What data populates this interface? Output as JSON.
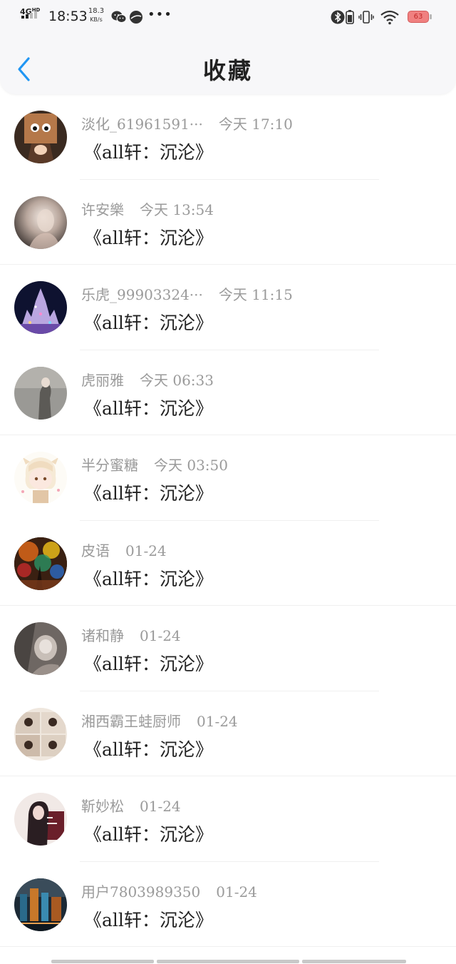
{
  "status_bar": {
    "network": "4G",
    "network_sup": "HD",
    "time": "18:53",
    "speed_value": "18.3",
    "speed_unit": "KB/s",
    "battery": "63",
    "battery_color": "#f08080"
  },
  "header": {
    "title": "收藏",
    "back_icon": "chevron-left-icon",
    "accent": "#2196f3",
    "background": "#f7f7f9"
  },
  "items": [
    {
      "name": "淡化_61961591···",
      "time": "今天 17:10",
      "content": "《all轩：沉沦》"
    },
    {
      "name": "许安樂",
      "time": "今天 13:54",
      "content": "《all轩：沉沦》"
    },
    {
      "name": "乐虎_99903324···",
      "time": "今天 11:15",
      "content": "《all轩：沉沦》"
    },
    {
      "name": "虎丽雅",
      "time": "今天 06:33",
      "content": "《all轩：沉沦》"
    },
    {
      "name": "半分蜜糖",
      "time": "今天 03:50",
      "content": "《all轩：沉沦》"
    },
    {
      "name": "皮语",
      "time": "01-24",
      "content": "《all轩：沉沦》"
    },
    {
      "name": "诸和静",
      "time": "01-24",
      "content": "《all轩：沉沦》"
    },
    {
      "name": "湘西霸王蛙厨师",
      "time": "01-24",
      "content": "《all轩：沉沦》"
    },
    {
      "name": "靳妙松",
      "time": "01-24",
      "content": "《all轩：沉沦》"
    },
    {
      "name": "用户7803989350",
      "time": "01-24",
      "content": "《all轩：沉沦》"
    }
  ]
}
